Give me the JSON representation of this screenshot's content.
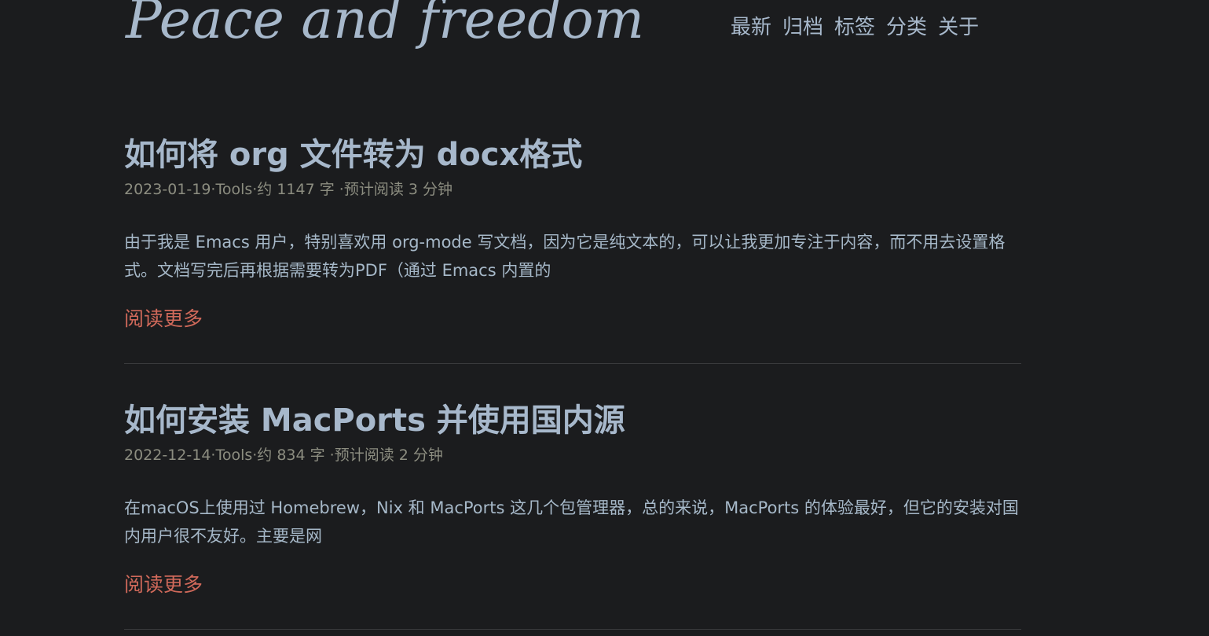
{
  "site": {
    "title": "Peace and freedom"
  },
  "nav": {
    "items": [
      {
        "label": "最新"
      },
      {
        "label": "归档"
      },
      {
        "label": "标签"
      },
      {
        "label": "分类"
      },
      {
        "label": "关于"
      }
    ]
  },
  "posts": [
    {
      "title": "如何将 org 文件转为 docx格式",
      "meta": "2023-01-19·Tools·约 1147 字 ·预计阅读 3 分钟",
      "summary": "由于我是 Emacs 用户，特别喜欢用 org-mode 写文档，因为它是纯文本的，可以让我更加专注于内容，而不用去设置格式。文档写完后再根据需要转为PDF（通过 Emacs 内置的",
      "read_more": "阅读更多"
    },
    {
      "title": "如何安装 MacPorts 并使用国内源",
      "meta": "2022-12-14·Tools·约 834 字 ·预计阅读 2 分钟",
      "summary": "在macOS上使用过 Homebrew，Nix 和 MacPorts 这几个包管理器，总的来说，MacPorts 的体验最好，但它的安装对国内用户很不友好。主要是网",
      "read_more": "阅读更多"
    }
  ],
  "colors": {
    "background": "#1b1c1e",
    "text": "#a6b8c8",
    "meta": "#8c8d80",
    "accent": "#d0695a",
    "divider": "#3a3b3d"
  }
}
